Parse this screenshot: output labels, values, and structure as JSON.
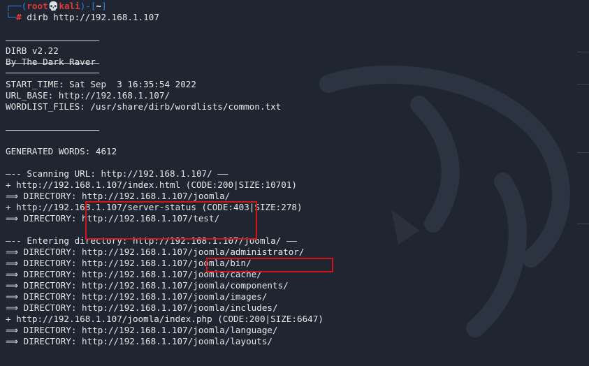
{
  "prompt": {
    "frame_top": "┌──(",
    "user": "root",
    "skull": "💀",
    "host": "kali",
    "sep": ")-[",
    "cwd": "~",
    "close": "]",
    "frame_bottom": "└─",
    "hash": "#",
    "command": "dirb http://192.168.1.107"
  },
  "banner": {
    "title": "DIRB v2.22",
    "author": "By The Dark Raver"
  },
  "info": {
    "start_time": "START_TIME: Sat Sep  3 16:35:54 2022",
    "url_base": "URL_BASE: http://192.168.1.107/",
    "wordlist": "WORDLIST_FILES: /usr/share/dirb/wordlists/common.txt"
  },
  "generated_words": "GENERATED WORDS: 4612",
  "scan1": {
    "header": "—-- Scanning URL: http://192.168.1.107/ ——",
    "lines": [
      "+ http://192.168.1.107/index.html (CODE:200|SIZE:10701)",
      "⟹ DIRECTORY: http://192.168.1.107/joomla/",
      "+ http://192.168.1.107/server-status (CODE:403|SIZE:278)",
      "⟹ DIRECTORY: http://192.168.1.107/test/"
    ]
  },
  "scan2": {
    "header": "—-- Entering directory: http://192.168.1.107/joomla/ ——",
    "lines": [
      "⟹ DIRECTORY: http://192.168.1.107/joomla/administrator/",
      "⟹ DIRECTORY: http://192.168.1.107/joomla/bin/",
      "⟹ DIRECTORY: http://192.168.1.107/joomla/cache/",
      "⟹ DIRECTORY: http://192.168.1.107/joomla/components/",
      "⟹ DIRECTORY: http://192.168.1.107/joomla/images/",
      "⟹ DIRECTORY: http://192.168.1.107/joomla/includes/",
      "+ http://192.168.1.107/joomla/index.php (CODE:200|SIZE:6647)",
      "⟹ DIRECTORY: http://192.168.1.107/joomla/language/",
      "⟹ DIRECTORY: http://192.168.1.107/joomla/layouts/"
    ]
  },
  "colors": {
    "background": "#1f2631",
    "prompt_blue": "#2f7cd6",
    "prompt_red": "#e03a3a",
    "highlight_box": "#d01616"
  }
}
